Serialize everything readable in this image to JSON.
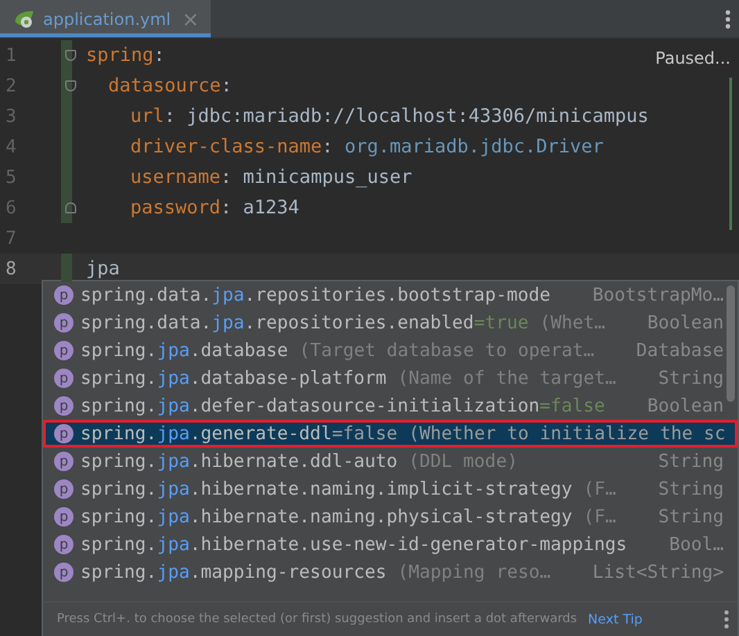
{
  "tab": {
    "title": "application.yml",
    "close": "×",
    "selected": true
  },
  "status": "Paused...",
  "lines": [
    {
      "number": "1",
      "key": "spring",
      "colon": ":",
      "fold": true,
      "children": [
        {
          "number": "2",
          "key": "datasource",
          "colon": ":",
          "fold": true,
          "children": [
            {
              "number": "3",
              "key": "url",
              "colon": ":",
              "value": "jdbc:mariadb://localhost:43306/minicampus",
              "kind": "plain"
            },
            {
              "number": "4",
              "key": "driver-class-name",
              "colon": ":",
              "value": "org.mariadb.jdbc.Driver",
              "kind": "class"
            },
            {
              "number": "5",
              "key": "username",
              "colon": ":",
              "value": "minicampus_user",
              "kind": "plain"
            },
            {
              "number": "6",
              "key": "password",
              "colon": ":",
              "value": "a1234",
              "kind": "plain",
              "fold_end": true
            }
          ]
        }
      ]
    },
    {
      "number": "7"
    },
    {
      "number": "8",
      "text": "jpa",
      "current": true
    }
  ],
  "completion": {
    "items": [
      {
        "icon": "p",
        "prefix": "spring.data.",
        "match": "jpa",
        "suffix": ".repositories.bootstrap-mode",
        "type": "BootstrapMo…",
        "selected": false
      },
      {
        "icon": "p",
        "prefix": "spring.data.",
        "match": "jpa",
        "suffix": ".repositories.enabled",
        "default": "=true",
        "description": "(Whet…",
        "type": "Boolean",
        "selected": false
      },
      {
        "icon": "p",
        "prefix": "spring.",
        "match": "jpa",
        "suffix": ".database",
        "description": "(Target database to operat…",
        "type": "Database",
        "selected": false
      },
      {
        "icon": "p",
        "prefix": "spring.",
        "match": "jpa",
        "suffix": ".database-platform",
        "description": "(Name of the target…",
        "type": "String",
        "selected": false
      },
      {
        "icon": "p",
        "prefix": "spring.",
        "match": "jpa",
        "suffix": ".defer-datasource-initialization",
        "default": "=false",
        "type": "Boolean",
        "selected": false
      },
      {
        "icon": "p",
        "prefix": "spring.",
        "match": "jpa",
        "suffix": ".generate-ddl",
        "default": "=false",
        "description": "(Whether to initialize the sc",
        "selected": true
      },
      {
        "icon": "p",
        "prefix": "spring.",
        "match": "jpa",
        "suffix": ".hibernate.ddl-auto",
        "description": "(DDL mode)",
        "type": "String",
        "selected": false
      },
      {
        "icon": "p",
        "prefix": "spring.",
        "match": "jpa",
        "suffix": ".hibernate.naming.implicit-strategy",
        "description": "(F…",
        "type": "String",
        "selected": false
      },
      {
        "icon": "p",
        "prefix": "spring.",
        "match": "jpa",
        "suffix": ".hibernate.naming.physical-strategy",
        "description": "(F…",
        "type": "String",
        "selected": false
      },
      {
        "icon": "p",
        "prefix": "spring.",
        "match": "jpa",
        "suffix": ".hibernate.use-new-id-generator-mappings",
        "type": "Bool…",
        "selected": false
      },
      {
        "icon": "p",
        "prefix": "spring.",
        "match": "jpa",
        "suffix": ".mapping-resources",
        "description": "(Mapping reso…",
        "type": "List<String>",
        "selected": false
      }
    ],
    "hint": "Press Ctrl+. to choose the selected (or first) suggestion and insert a dot afterwards",
    "link": "Next Tip"
  }
}
